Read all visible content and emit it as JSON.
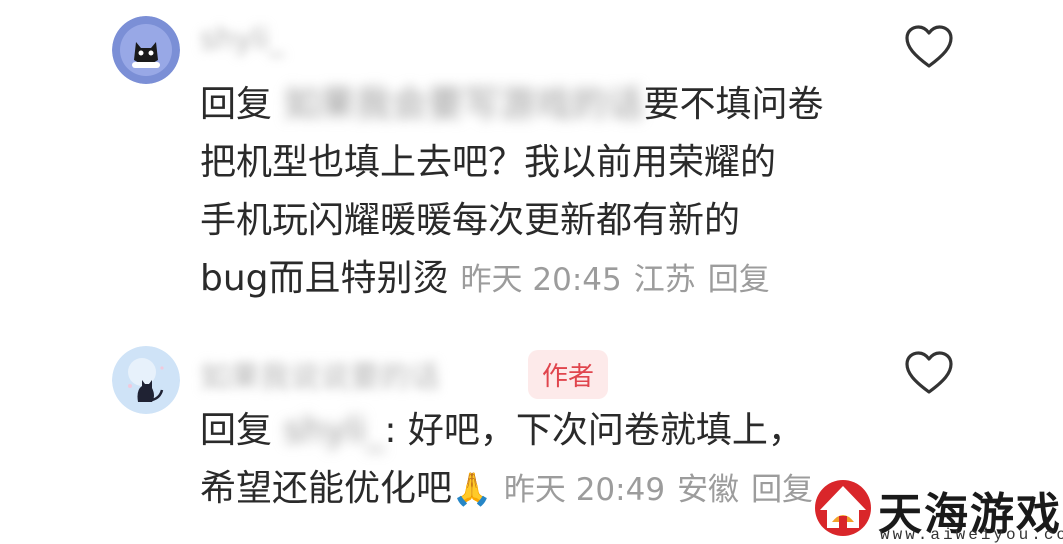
{
  "comments": [
    {
      "username": "shyli_",
      "reply_prefix": "回复",
      "mention": "如果我会要写游戏的话",
      "lines": [
        "要不填问卷",
        "把机型也填上去吧？我以前用荣耀的",
        "手机玩闪耀暖暖每次更新都有新的",
        "bug而且特别烫"
      ],
      "time": "昨天 20:45",
      "location": "江苏",
      "reply_label": "回复"
    },
    {
      "username": "如果我说说要的话",
      "author_badge": "作者",
      "reply_prefix": "回复",
      "mention": "shyli_",
      "lines": [
        ": 好吧，下次问卷就填上，",
        "希望还能优化吧"
      ],
      "emoji": "🙏",
      "time": "昨天 20:49",
      "location": "安徽",
      "reply_label": "回复"
    }
  ],
  "watermark": {
    "title": "天海游戏网",
    "url": "www.aiweiyou.com"
  },
  "colors": {
    "badge_text": "#e0454d",
    "badge_bg": "#fdeaea",
    "meta": "#9c9c9c"
  }
}
